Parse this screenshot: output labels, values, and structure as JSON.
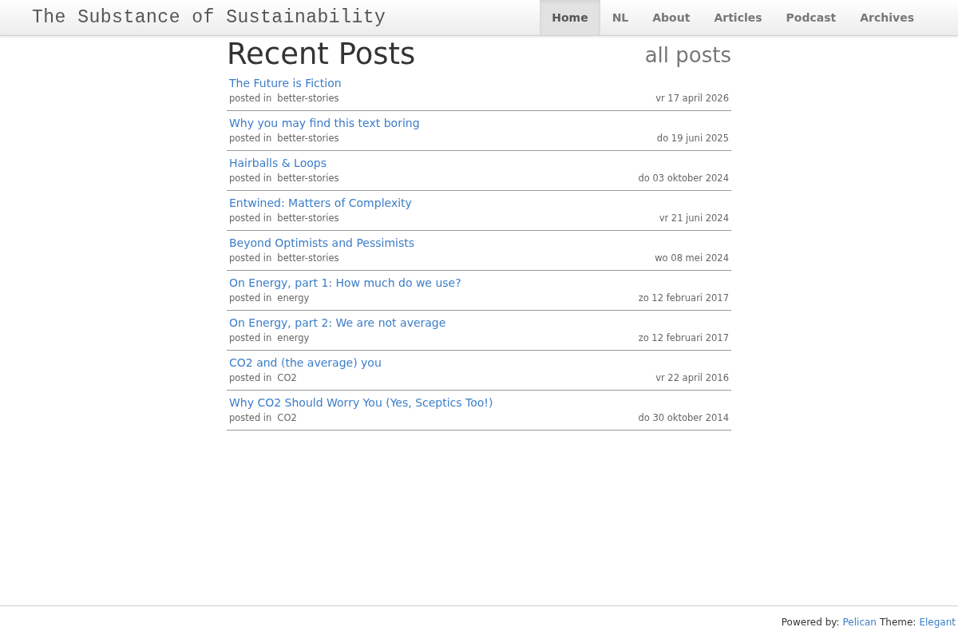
{
  "site_title": "The Substance of Sustainability",
  "nav": [
    {
      "label": "Home",
      "selected": true
    },
    {
      "label": "NL",
      "selected": false
    },
    {
      "label": "About",
      "selected": false
    },
    {
      "label": "Articles",
      "selected": false
    },
    {
      "label": "Podcast",
      "selected": false
    },
    {
      "label": "Archives",
      "selected": false
    }
  ],
  "heading": "Recent Posts",
  "all_posts_link": "all posts",
  "posts": [
    {
      "title": "The Future is Fiction",
      "posted_in": "posted in",
      "category": "better-stories",
      "date": "vr 17 april 2026"
    },
    {
      "title": "Why you may find this text boring",
      "posted_in": "posted in",
      "category": "better-stories",
      "date": "do 19 juni 2025"
    },
    {
      "title": "Hairballs & Loops",
      "posted_in": "posted in",
      "category": "better-stories",
      "date": "do 03 oktober 2024"
    },
    {
      "title": "Entwined: Matters of Complexity",
      "posted_in": "posted in",
      "category": "better-stories",
      "date": "vr 21 juni 2024"
    },
    {
      "title": "Beyond Optimists and Pessimists",
      "posted_in": "posted in",
      "category": "better-stories",
      "date": "wo 08 mei 2024"
    },
    {
      "title": "On Energy, part 1: How much do we use?",
      "posted_in": "posted in",
      "category": "energy",
      "date": "zo 12 februari 2017"
    },
    {
      "title": "On Energy, part 2: We are not average",
      "posted_in": "posted in",
      "category": "energy",
      "date": "zo 12 februari 2017"
    },
    {
      "title": "CO2 and (the average) you",
      "posted_in": "posted in",
      "category": "CO2",
      "date": "vr 22 april 2016"
    },
    {
      "title": "Why CO2 Should Worry You (Yes, Sceptics Too!)",
      "posted_in": "posted in",
      "category": "CO2",
      "date": "do 30 oktober 2014"
    }
  ],
  "footer": {
    "powered_by": "Powered by:",
    "pelican_link": "Pelican",
    "theme_label": "Theme:",
    "elegant_link": "Elegant"
  }
}
